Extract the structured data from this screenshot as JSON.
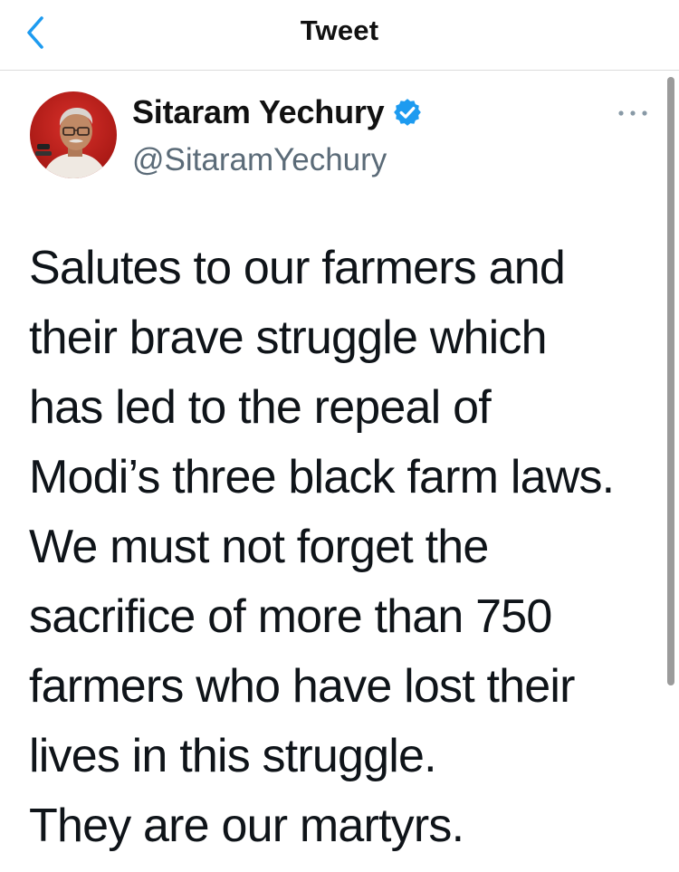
{
  "header": {
    "title": "Tweet",
    "back_icon": "chevron-left-icon",
    "accent_color": "#1d9bf0"
  },
  "tweet": {
    "author": {
      "display_name": "Sitaram Yechury",
      "handle": "@SitaramYechury",
      "verified": true,
      "verified_icon": "verified-badge-icon"
    },
    "more_icon": "more-horizontal-icon",
    "text_lines": [
      "Salutes to our farmers and",
      "their brave struggle which",
      "has led to the repeal of",
      "Modi’s three black farm laws.",
      "We must not forget the",
      "sacrifice of more than 750",
      "farmers who have lost their",
      "lives in this struggle.",
      "They are our martyrs."
    ]
  }
}
